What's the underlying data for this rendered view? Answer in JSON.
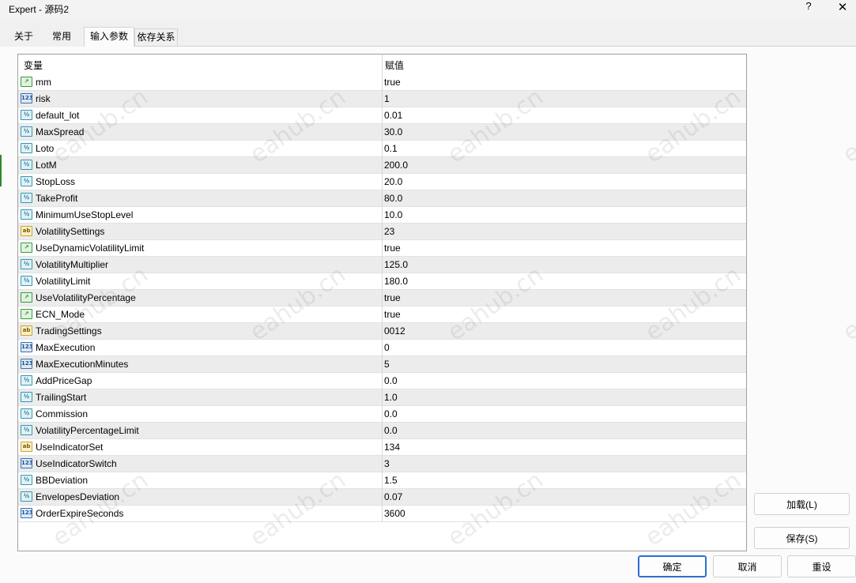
{
  "window": {
    "title": "Expert - 源码2",
    "help": "?",
    "close": "✕"
  },
  "tabs": [
    {
      "label": "关于"
    },
    {
      "label": "常用"
    },
    {
      "label": "输入参数"
    },
    {
      "label": "依存关系"
    }
  ],
  "table": {
    "headers": {
      "variable": "变量",
      "value": "赋值"
    },
    "rows": [
      {
        "type": "bool",
        "name": "mm",
        "value": "true"
      },
      {
        "type": "int",
        "name": "risk",
        "value": "1"
      },
      {
        "type": "double",
        "name": "default_lot",
        "value": "0.01"
      },
      {
        "type": "double",
        "name": "MaxSpread",
        "value": "30.0"
      },
      {
        "type": "double",
        "name": "Loto",
        "value": "0.1"
      },
      {
        "type": "double",
        "name": "LotM",
        "value": "200.0"
      },
      {
        "type": "double",
        "name": "StopLoss",
        "value": "20.0"
      },
      {
        "type": "double",
        "name": "TakeProfit",
        "value": "80.0"
      },
      {
        "type": "double",
        "name": "MinimumUseStopLevel",
        "value": "10.0"
      },
      {
        "type": "string",
        "name": "VolatilitySettings",
        "value": "23"
      },
      {
        "type": "bool",
        "name": "UseDynamicVolatilityLimit",
        "value": "true"
      },
      {
        "type": "double",
        "name": "VolatilityMultiplier",
        "value": "125.0"
      },
      {
        "type": "double",
        "name": "VolatilityLimit",
        "value": "180.0"
      },
      {
        "type": "bool",
        "name": "UseVolatilityPercentage",
        "value": "true"
      },
      {
        "type": "bool",
        "name": "ECN_Mode",
        "value": "true"
      },
      {
        "type": "string",
        "name": "TradingSettings",
        "value": "0012"
      },
      {
        "type": "int",
        "name": "MaxExecution",
        "value": "0"
      },
      {
        "type": "int",
        "name": "MaxExecutionMinutes",
        "value": "5"
      },
      {
        "type": "double",
        "name": "AddPriceGap",
        "value": "0.0"
      },
      {
        "type": "double",
        "name": "TrailingStart",
        "value": "1.0"
      },
      {
        "type": "double",
        "name": "Commission",
        "value": "0.0"
      },
      {
        "type": "double",
        "name": "VolatilityPercentageLimit",
        "value": "0.0"
      },
      {
        "type": "string",
        "name": "UseIndicatorSet",
        "value": "134"
      },
      {
        "type": "int",
        "name": "UseIndicatorSwitch",
        "value": "3"
      },
      {
        "type": "double",
        "name": "BBDeviation",
        "value": "1.5"
      },
      {
        "type": "double",
        "name": "EnvelopesDeviation",
        "value": "0.07"
      },
      {
        "type": "int",
        "name": "OrderExpireSeconds",
        "value": "3600"
      }
    ]
  },
  "type_icons": {
    "bool": {
      "glyph": "↗",
      "icon": "bool-type-icon",
      "color": "#3a9a3a"
    },
    "int": {
      "glyph": "123",
      "icon": "integer-type-icon",
      "color": "#3a6fb0"
    },
    "double": {
      "glyph": "½",
      "icon": "double-type-icon",
      "color": "#3a93b0"
    },
    "string": {
      "glyph": "ab",
      "icon": "string-type-icon",
      "color": "#c9a23a"
    }
  },
  "buttons": {
    "load": "加载(L)",
    "save": "保存(S)",
    "ok": "确定",
    "cancel": "取消",
    "reset": "重设"
  },
  "watermark": "eahub.cn",
  "colors": {
    "accent": "#2a6fd0",
    "alt_row": "#ececec"
  }
}
